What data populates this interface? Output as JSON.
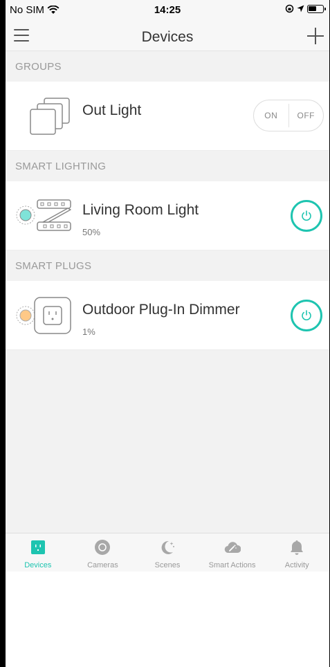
{
  "status_bar": {
    "carrier": "No SIM",
    "time": "14:25"
  },
  "nav": {
    "title": "Devices"
  },
  "sections": [
    {
      "header": "GROUPS",
      "device": {
        "name": "Out Light",
        "on_label": "ON",
        "off_label": "OFF"
      }
    },
    {
      "header": "SMART LIGHTING",
      "device": {
        "name": "Living Room Light",
        "level": "50%",
        "indicator_color": "#7fe3d8"
      }
    },
    {
      "header": "SMART PLUGS",
      "device": {
        "name": "Outdoor Plug-In Dimmer",
        "level": "1%",
        "indicator_color": "#ffc987"
      }
    }
  ],
  "tabs": [
    {
      "label": "Devices",
      "icon": "plug-icon",
      "active": true
    },
    {
      "label": "Cameras",
      "icon": "camera-icon",
      "active": false
    },
    {
      "label": "Scenes",
      "icon": "moon-stars-icon",
      "active": false
    },
    {
      "label": "Smart Actions",
      "icon": "cloud-wand-icon",
      "active": false
    },
    {
      "label": "Activity",
      "icon": "bell-icon",
      "active": false
    }
  ],
  "colors": {
    "accent": "#1ec4b0",
    "tab_inactive": "#a8a8a8"
  }
}
